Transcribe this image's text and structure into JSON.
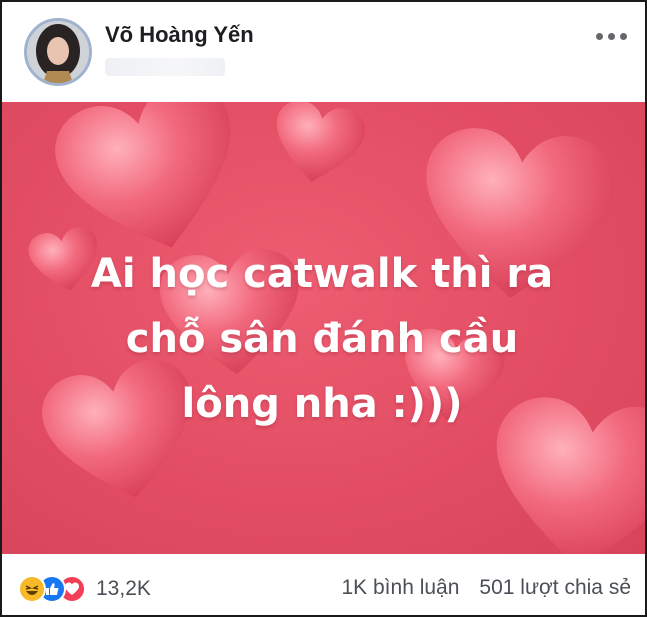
{
  "post": {
    "author_name": "Võ Hoàng Yến",
    "image_text_lines": [
      "Ai học catwalk thì ra",
      "chỗ sân đánh cầu",
      "lông nha :)))"
    ]
  },
  "footer": {
    "reaction_icons": [
      "haha-icon",
      "like-icon",
      "love-icon"
    ],
    "reaction_count": "13,2K",
    "comments": "1K bình luận",
    "shares": "501 lượt chia sẻ"
  },
  "colors": {
    "background_red": "#e24d63",
    "heart_red": "#f2667a",
    "like_blue": "#1877f2",
    "love_red": "#f33e58",
    "haha_yellow": "#f7b928"
  }
}
